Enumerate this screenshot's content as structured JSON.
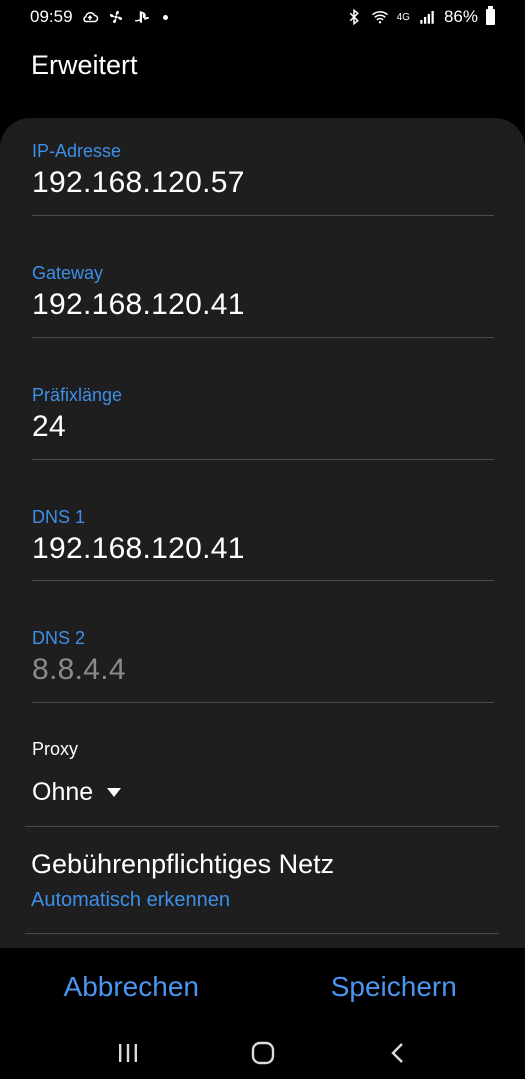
{
  "status_bar": {
    "time": "09:59",
    "network_type": "4G",
    "battery_percent": "86%",
    "icons_left": [
      "cloud-upload-icon",
      "fan-icon",
      "playstation-icon",
      "dot-icon"
    ],
    "icons_right": [
      "bluetooth-icon",
      "wifi-icon",
      "signal-icon",
      "battery-icon"
    ]
  },
  "header": {
    "title": "Erweitert"
  },
  "fields": {
    "ip": {
      "label": "IP-Adresse",
      "value": "192.168.120.57"
    },
    "gateway": {
      "label": "Gateway",
      "value": "192.168.120.41"
    },
    "prefix": {
      "label": "Präfixlänge",
      "value": "24"
    },
    "dns1": {
      "label": "DNS 1",
      "value": "192.168.120.41"
    },
    "dns2": {
      "label": "DNS 2",
      "value": "8.8.4.4"
    }
  },
  "proxy": {
    "label": "Proxy",
    "value": "Ohne"
  },
  "metered": {
    "title": "Gebührenpflichtiges Netz",
    "value": "Automatisch erkennen"
  },
  "actions": {
    "cancel": "Abbrechen",
    "save": "Speichern"
  },
  "colors": {
    "accent": "#3e8fe8",
    "card_background": "#1e1e1e",
    "background": "#000000"
  }
}
